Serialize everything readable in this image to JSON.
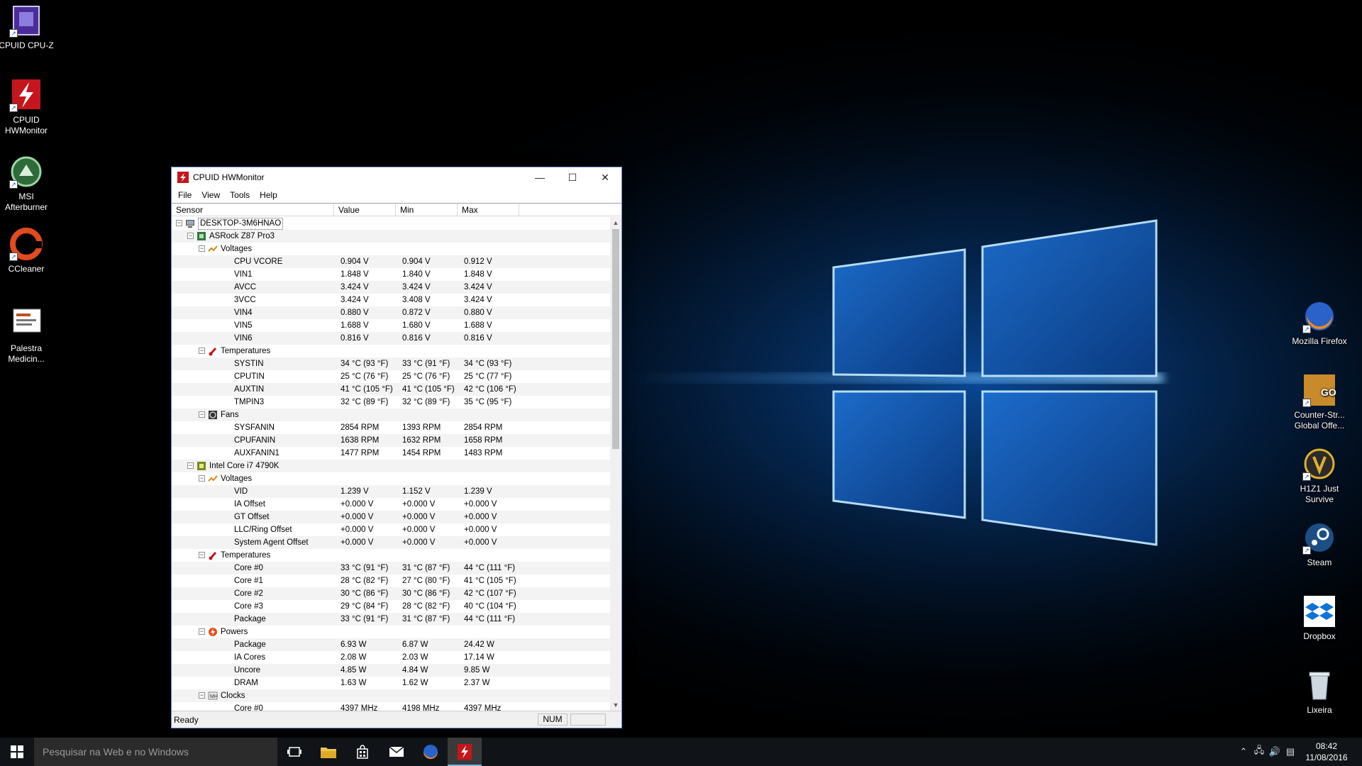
{
  "desktop": {
    "left_icons": [
      {
        "label": "CPUID CPU-Z",
        "icon": "cpuz-icon"
      },
      {
        "label": "CPUID HWMonitor",
        "icon": "hwmonitor-icon"
      },
      {
        "label": "MSI Afterburner",
        "icon": "afterburner-icon"
      },
      {
        "label": "CCleaner",
        "icon": "ccleaner-icon"
      },
      {
        "label": "Palestra Medicin...",
        "icon": "powerpoint-file-icon"
      }
    ],
    "right_icons": [
      {
        "label": "Mozilla Firefox",
        "icon": "firefox-icon"
      },
      {
        "label": "Counter-Str... Global Offe...",
        "icon": "csgo-icon"
      },
      {
        "label": "H1Z1 Just Survive",
        "icon": "h1z1-icon"
      },
      {
        "label": "Steam",
        "icon": "steam-icon"
      },
      {
        "label": "Dropbox",
        "icon": "dropbox-icon"
      },
      {
        "label": "Lixeira",
        "icon": "recycle-bin-icon"
      }
    ]
  },
  "window": {
    "title": "CPUID HWMonitor",
    "menu": [
      "File",
      "View",
      "Tools",
      "Help"
    ],
    "columns": {
      "sensor": "Sensor",
      "value": "Value",
      "min": "Min",
      "max": "Max"
    },
    "rows": [
      {
        "level": 0,
        "exp": "-",
        "icon": "computer",
        "name": "DESKTOP-3M6HNAO",
        "value": "",
        "min": "",
        "max": ""
      },
      {
        "level": 1,
        "exp": "-",
        "icon": "board",
        "name": "ASRock Z87 Pro3",
        "value": "",
        "min": "",
        "max": ""
      },
      {
        "level": 2,
        "exp": "-",
        "icon": "volt",
        "name": "Voltages",
        "value": "",
        "min": "",
        "max": ""
      },
      {
        "level": 3,
        "name": "CPU VCORE",
        "value": "0.904 V",
        "min": "0.904 V",
        "max": "0.912 V"
      },
      {
        "level": 3,
        "name": "VIN1",
        "value": "1.848 V",
        "min": "1.840 V",
        "max": "1.848 V"
      },
      {
        "level": 3,
        "name": "AVCC",
        "value": "3.424 V",
        "min": "3.424 V",
        "max": "3.424 V"
      },
      {
        "level": 3,
        "name": "3VCC",
        "value": "3.424 V",
        "min": "3.408 V",
        "max": "3.424 V"
      },
      {
        "level": 3,
        "name": "VIN4",
        "value": "0.880 V",
        "min": "0.872 V",
        "max": "0.880 V"
      },
      {
        "level": 3,
        "name": "VIN5",
        "value": "1.688 V",
        "min": "1.680 V",
        "max": "1.688 V"
      },
      {
        "level": 3,
        "name": "VIN6",
        "value": "0.816 V",
        "min": "0.816 V",
        "max": "0.816 V"
      },
      {
        "level": 2,
        "exp": "-",
        "icon": "temp",
        "name": "Temperatures",
        "value": "",
        "min": "",
        "max": ""
      },
      {
        "level": 3,
        "name": "SYSTIN",
        "value": "34 °C  (93 °F)",
        "min": "33 °C  (91 °F)",
        "max": "34 °C  (93 °F)"
      },
      {
        "level": 3,
        "name": "CPUTIN",
        "value": "25 °C  (76 °F)",
        "min": "25 °C  (76 °F)",
        "max": "25 °C  (77 °F)"
      },
      {
        "level": 3,
        "name": "AUXTIN",
        "value": "41 °C  (105 °F)",
        "min": "41 °C  (105 °F)",
        "max": "42 °C  (106 °F)"
      },
      {
        "level": 3,
        "name": "TMPIN3",
        "value": "32 °C  (89 °F)",
        "min": "32 °C  (89 °F)",
        "max": "35 °C  (95 °F)"
      },
      {
        "level": 2,
        "exp": "-",
        "icon": "fan",
        "name": "Fans",
        "value": "",
        "min": "",
        "max": ""
      },
      {
        "level": 3,
        "name": "SYSFANIN",
        "value": "2854 RPM",
        "min": "1393 RPM",
        "max": "2854 RPM"
      },
      {
        "level": 3,
        "name": "CPUFANIN",
        "value": "1638 RPM",
        "min": "1632 RPM",
        "max": "1658 RPM"
      },
      {
        "level": 3,
        "name": "AUXFANIN1",
        "value": "1477 RPM",
        "min": "1454 RPM",
        "max": "1483 RPM"
      },
      {
        "level": 1,
        "exp": "-",
        "icon": "cpu",
        "name": "Intel Core i7 4790K",
        "value": "",
        "min": "",
        "max": ""
      },
      {
        "level": 2,
        "exp": "-",
        "icon": "volt",
        "name": "Voltages",
        "value": "",
        "min": "",
        "max": ""
      },
      {
        "level": 3,
        "name": "VID",
        "value": "1.239 V",
        "min": "1.152 V",
        "max": "1.239 V"
      },
      {
        "level": 3,
        "name": "IA Offset",
        "value": "+0.000 V",
        "min": "+0.000 V",
        "max": "+0.000 V"
      },
      {
        "level": 3,
        "name": "GT Offset",
        "value": "+0.000 V",
        "min": "+0.000 V",
        "max": "+0.000 V"
      },
      {
        "level": 3,
        "name": "LLC/Ring Offset",
        "value": "+0.000 V",
        "min": "+0.000 V",
        "max": "+0.000 V"
      },
      {
        "level": 3,
        "name": "System Agent Offset",
        "value": "+0.000 V",
        "min": "+0.000 V",
        "max": "+0.000 V"
      },
      {
        "level": 2,
        "exp": "-",
        "icon": "temp",
        "name": "Temperatures",
        "value": "",
        "min": "",
        "max": ""
      },
      {
        "level": 3,
        "name": "Core #0",
        "value": "33 °C  (91 °F)",
        "min": "31 °C  (87 °F)",
        "max": "44 °C  (111 °F)"
      },
      {
        "level": 3,
        "name": "Core #1",
        "value": "28 °C  (82 °F)",
        "min": "27 °C  (80 °F)",
        "max": "41 °C  (105 °F)"
      },
      {
        "level": 3,
        "name": "Core #2",
        "value": "30 °C  (86 °F)",
        "min": "30 °C  (86 °F)",
        "max": "42 °C  (107 °F)"
      },
      {
        "level": 3,
        "name": "Core #3",
        "value": "29 °C  (84 °F)",
        "min": "28 °C  (82 °F)",
        "max": "40 °C  (104 °F)"
      },
      {
        "level": 3,
        "name": "Package",
        "value": "33 °C  (91 °F)",
        "min": "31 °C  (87 °F)",
        "max": "44 °C  (111 °F)"
      },
      {
        "level": 2,
        "exp": "-",
        "icon": "power",
        "name": "Powers",
        "value": "",
        "min": "",
        "max": ""
      },
      {
        "level": 3,
        "name": "Package",
        "value": "6.93 W",
        "min": "6.87 W",
        "max": "24.42 W"
      },
      {
        "level": 3,
        "name": "IA Cores",
        "value": "2.08 W",
        "min": "2.03 W",
        "max": "17.14 W"
      },
      {
        "level": 3,
        "name": "Uncore",
        "value": "4.85 W",
        "min": "4.84 W",
        "max": "9.85 W"
      },
      {
        "level": 3,
        "name": "DRAM",
        "value": "1.63 W",
        "min": "1.62 W",
        "max": "2.37 W"
      },
      {
        "level": 2,
        "exp": "-",
        "icon": "clock",
        "name": "Clocks",
        "value": "",
        "min": "",
        "max": ""
      },
      {
        "level": 3,
        "name": "Core #0",
        "value": "4397 MHz",
        "min": "4198 MHz",
        "max": "4397 MHz"
      }
    ],
    "status": {
      "text": "Ready",
      "num": "NUM"
    }
  },
  "taskbar": {
    "search_placeholder": "Pesquisar na Web e no Windows",
    "pinned": [
      "task-view-icon",
      "file-explorer-icon",
      "store-icon",
      "mail-icon",
      "firefox-icon",
      "hwmonitor-icon"
    ],
    "clock_time": "08:42",
    "clock_date": "11/08/2016"
  },
  "colors": {
    "wallpaper_glow": "#3fa0ff",
    "accent": "#c4161c"
  }
}
